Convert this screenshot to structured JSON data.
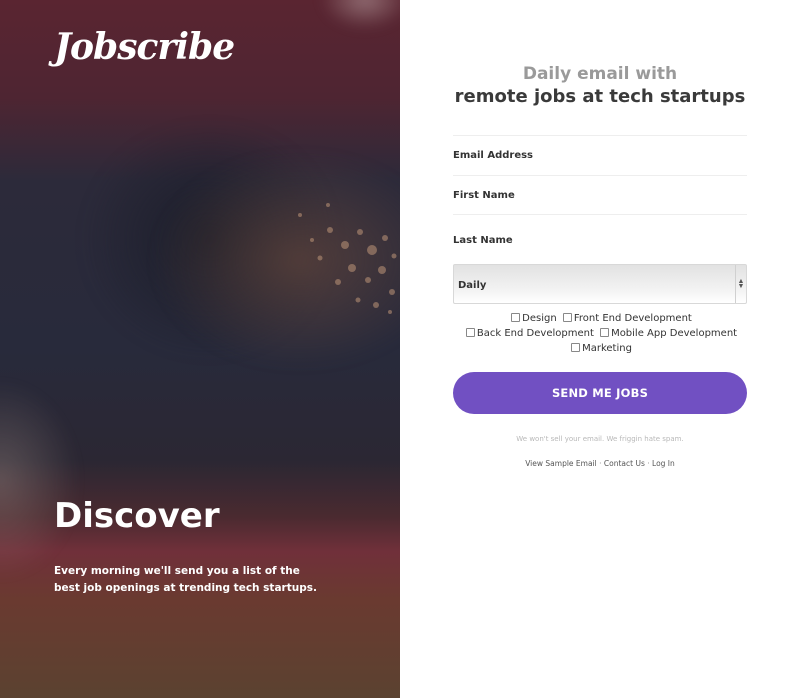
{
  "hero": {
    "logo": "Jobscribe",
    "headline": "Discover",
    "subline": "Every morning we'll send you a list of the best job openings at trending tech startups."
  },
  "form": {
    "tagline_line1": "Daily email with",
    "tagline_line2": "remote jobs at tech startups",
    "email_label": "Email Address",
    "first_name_label": "First Name",
    "last_name_label": "Last Name",
    "frequency_value": "Daily",
    "categories": [
      {
        "label": "Design",
        "checked": false
      },
      {
        "label": "Front End Development",
        "checked": false
      },
      {
        "label": "Back End Development",
        "checked": false
      },
      {
        "label": "Mobile App Development",
        "checked": false
      },
      {
        "label": "Marketing",
        "checked": false
      }
    ],
    "submit_label": "SEND ME JOBS",
    "spam_note": "We won't sell your email. We friggin hate spam.",
    "links": {
      "sample": "View Sample Email",
      "contact": "Contact Us",
      "login": "Log In",
      "separator": "·"
    }
  },
  "colors": {
    "accent": "#7150c2",
    "text_dark": "#3a3a3a",
    "text_muted": "#9a9a9a"
  }
}
